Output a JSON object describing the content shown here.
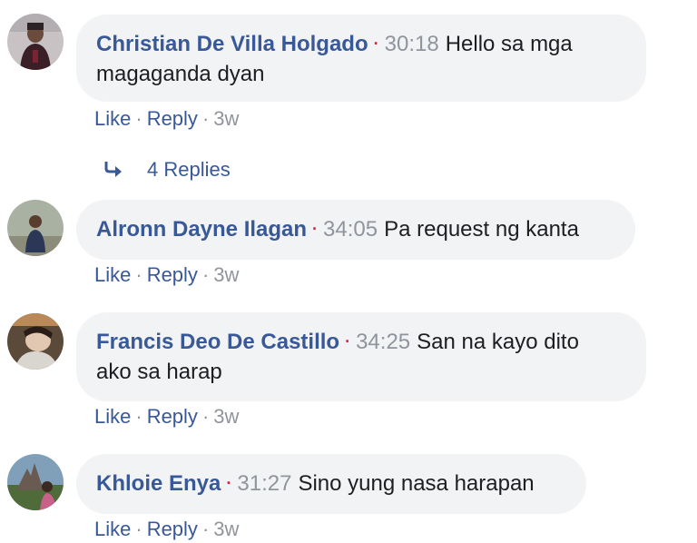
{
  "comments": [
    {
      "author": "Christian De Villa Holgado",
      "timestamp": "30:18",
      "text_line1": "Hello sa mga",
      "text_line2": "magaganda dyan",
      "like": "Like",
      "reply": "Reply",
      "age": "3w"
    },
    {
      "author": "Alronn Dayne Ilagan",
      "timestamp": "34:05",
      "text_line1": "Pa request ng kanta",
      "like": "Like",
      "reply": "Reply",
      "age": "3w"
    },
    {
      "author": "Francis Deo De Castillo",
      "timestamp": "34:25",
      "text_line1": "San na kayo dito",
      "text_line2": "ako sa harap",
      "like": "Like",
      "reply": "Reply",
      "age": "3w"
    },
    {
      "author": "Khloie Enya",
      "timestamp": "31:27",
      "text_line1": "Sino yung nasa harapan",
      "like": "Like",
      "reply": "Reply",
      "age": "3w"
    }
  ],
  "replies_link": {
    "label": "4 Replies",
    "icon": "reply-arrow-icon"
  },
  "separators": {
    "dot": "·",
    "mid": "·"
  },
  "colors": {
    "link": "#385898",
    "bubble": "#f2f3f5",
    "timestamp": "#90949c",
    "live_dot": "#e41e3f"
  }
}
